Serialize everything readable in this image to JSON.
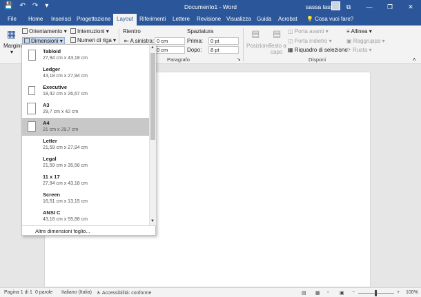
{
  "app": {
    "doc_title": "Documento1 - Word",
    "user_name": "sassa lassa"
  },
  "window": {
    "minimize": "—",
    "restore": "❐",
    "close": "✕",
    "ribbon_opts": "⧉"
  },
  "tabs": [
    "File",
    "Home",
    "Inserisci",
    "Progettazione",
    "Layout",
    "Riferimenti",
    "Lettere",
    "Revisione",
    "Visualizza",
    "Guida",
    "Acrobat"
  ],
  "active_tab": "Layout",
  "tell_me": "Cosa vuoi fare?",
  "ribbon": {
    "margini": "Margini",
    "orientamento": "Orientamento",
    "dimensioni": "Dimensioni",
    "interruzioni": "Interruzioni",
    "numeri_riga": "Numeri di riga",
    "rientro": "Rientro",
    "a_sinistra": "A sinistra:",
    "a_sinistra_value": "0 cm",
    "a_destra_value": "0 cm",
    "spaziatura": "Spaziatura",
    "prima": "Prima:",
    "prima_value": "0 pt",
    "dopo": "Dopo:",
    "dopo_value": "8 pt",
    "group_paragrafo": "Paragrafo",
    "posizione": "Posizione",
    "testo_a_capo_1": "Testo a",
    "testo_a_capo_2": "capo",
    "porta_avanti": "Porta avanti",
    "porta_indietro": "Porta indietro",
    "riquadro_selezione": "Riquadro di selezione",
    "allinea": "Allinea",
    "raggruppa": "Raggruppa",
    "ruota": "Ruota",
    "group_disponi": "Disponi"
  },
  "paper_sizes": [
    {
      "name": "Tabloid",
      "size": "27,94 cm x 43,18 cm"
    },
    {
      "name": "Ledger",
      "size": "43,18 cm x 27,94 cm"
    },
    {
      "name": "Executive",
      "size": "18,42 cm x 26,67 cm"
    },
    {
      "name": "A3",
      "size": "29,7 cm x 42 cm"
    },
    {
      "name": "A4",
      "size": "21 cm x 29,7 cm"
    },
    {
      "name": "Letter",
      "size": "21,59 cm x 27,94 cm"
    },
    {
      "name": "Legal",
      "size": "21,59 cm x 35,56 cm"
    },
    {
      "name": "11 x 17",
      "size": "27,94 cm x 43,18 cm"
    },
    {
      "name": "Screen",
      "size": "16,51 cm x 13,15 cm"
    },
    {
      "name": "ANSI C",
      "size": "43,18 cm x 55,88 cm"
    }
  ],
  "selected_paper": "A4",
  "more_sizes": "Altre dimensioni foglio...",
  "status": {
    "page": "Pagina 1 di 1",
    "words": "0 parole",
    "language": "Italiano (Italia)",
    "accessibility": "Accessibilità: conforme",
    "zoom": "100%"
  },
  "colors": {
    "accent": "#2b579a",
    "selection": "#c8c8c8"
  }
}
